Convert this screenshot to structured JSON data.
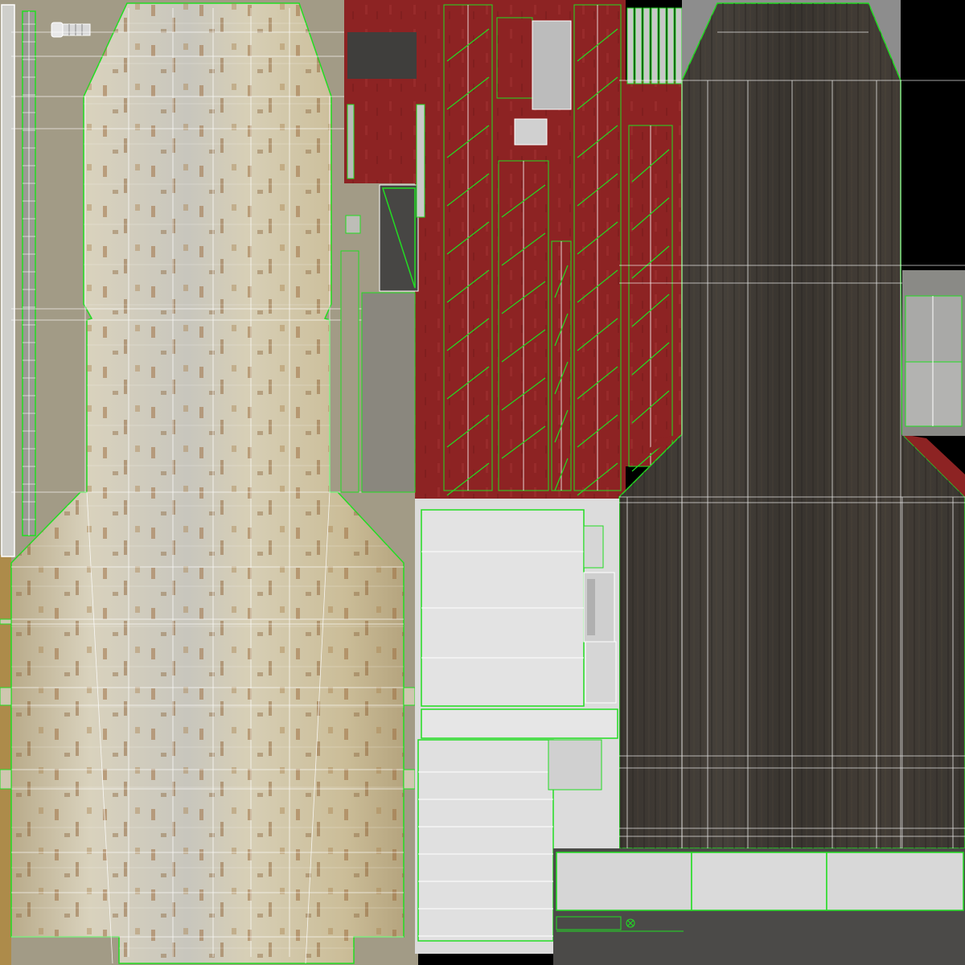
{
  "texture_sheet": {
    "palette": {
      "background": "#000000",
      "beige_margin": "#a29b86",
      "rust_plate_base": "#cdc6b1",
      "rust_stain": "#9a6a3a",
      "dark_wood": "#3c3833",
      "wood_grain": "#2b2824",
      "red_panel": "#8d2323",
      "light_gray_panel": "#dcdcdc",
      "mid_gray_panel": "#8a8a86",
      "dark_gray_strip": "#4b4a48",
      "uv_green": "#22dd22",
      "uv_white": "#ffffff"
    },
    "islands": [
      "left-strip-island",
      "narrow-rod-island",
      "rusted-hull-island",
      "red-parts-island",
      "dark-wood-hull-island",
      "gray-small-island",
      "white-panels-island",
      "bottom-gray-strips-island"
    ],
    "icons": [
      "bolt-icon",
      "crossed-circle-icon"
    ]
  }
}
